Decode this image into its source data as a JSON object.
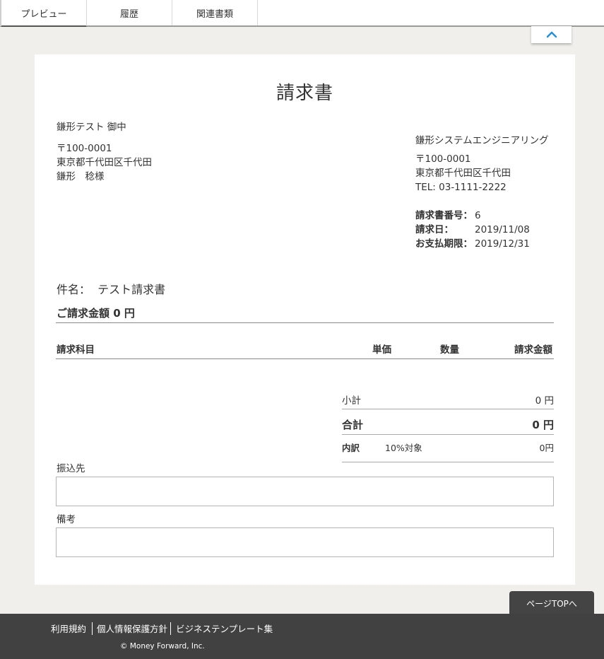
{
  "tabs": [
    {
      "label": "プレビュー"
    },
    {
      "label": "履歴"
    },
    {
      "label": "関連書類"
    }
  ],
  "collapse_icon": "chevron-up-icon",
  "accent_color": "#2a8fd0",
  "document": {
    "title": "請求書",
    "client": {
      "name": "鎌形テスト 御中",
      "postal": "〒100-0001",
      "address": "東京都千代田区千代田",
      "contact": "鎌形　稔様"
    },
    "issuer": {
      "name": "鎌形システムエンジニアリング",
      "postal": "〒100-0001",
      "address": "東京都千代田区千代田",
      "tel": "TEL: 03-1111-2222"
    },
    "meta": {
      "number_label": "請求書番号：",
      "number_value": "6",
      "date_label": "請求日：",
      "date_value": "2019/11/08",
      "due_label": "お支払期限：",
      "due_value": "2019/12/31"
    },
    "subject": "件名：  テスト請求書",
    "amount": "ご請求金額 0 円",
    "table_headers": {
      "item": "請求科目",
      "unit_price": "単価",
      "quantity": "数量",
      "amount": "請求金額"
    },
    "totals": {
      "subtotal_label": "小計",
      "subtotal_value": "0 円",
      "total_label": "合計",
      "total_value": "0 円",
      "breakdown_label": "内訳",
      "tax_category": "10%対象",
      "tax_value": "0円"
    },
    "bank_label": "振込先",
    "notes_label": "備考"
  },
  "page_top_label": "ページTOPへ",
  "footer": {
    "links": [
      "利用規約",
      "個人情報保護方針",
      "ビジネステンプレート集"
    ],
    "copyright": "© Money Forward, Inc."
  }
}
